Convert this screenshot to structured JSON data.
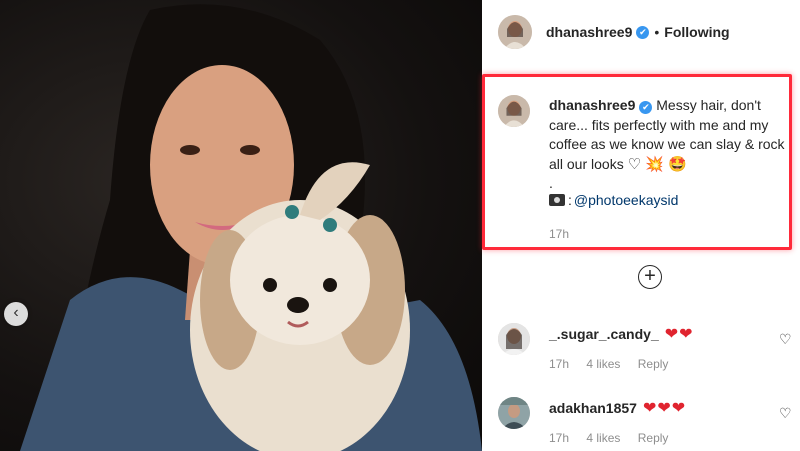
{
  "post": {
    "author": "dhanashree9",
    "follow_state": "Following",
    "separator": "•",
    "caption_text": "Messy hair, don't care... fits perfectly with me and my coffee as we know we can slay & rock all our looks",
    "caption_emojis": "♡ 💥 🤩",
    "caption_dot": ".",
    "credit_mention": "@photoeekaysid",
    "caption_time": "17h"
  },
  "icons": {
    "verified": "✔",
    "carousel_prev": "‹",
    "load_more": "+",
    "comment_like": "♡"
  },
  "comments": [
    {
      "username": "_.sugar_.candy_",
      "text": "❤❤",
      "time": "17h",
      "likes": "4 likes",
      "reply": "Reply"
    },
    {
      "username": "adakhan1857",
      "text": "❤❤❤",
      "time": "17h",
      "likes": "4 likes",
      "reply": "Reply"
    }
  ],
  "colors": {
    "highlight_border": "#ff2a3a",
    "verified_badge": "#3897f0",
    "mention_link": "#00376b",
    "muted_text": "#8e8e8e",
    "heart_red": "#e0242f"
  }
}
